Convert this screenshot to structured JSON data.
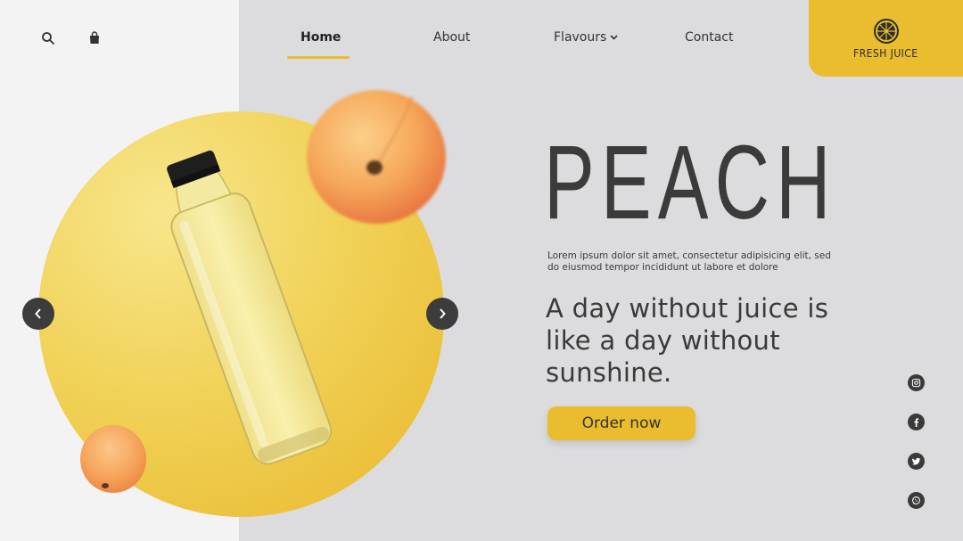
{
  "header": {
    "icons": {
      "search": "search-icon",
      "bag": "shopping-bag-icon"
    },
    "nav": [
      {
        "label": "Home",
        "active": true
      },
      {
        "label": "About",
        "active": false
      },
      {
        "label": "Flavours",
        "active": false,
        "dropdown": true
      },
      {
        "label": "Contact",
        "active": false
      }
    ],
    "logo": {
      "text": "FRESH JUICE",
      "icon": "citrus-slice-icon"
    }
  },
  "hero": {
    "title": "PEACH",
    "description": "Lorem ipsum dolor sit amet, consectetur adipisicing elit, sed do eiusmod tempor incididunt ut labore et dolore",
    "tagline": "A day without juice is like a day without sunshine.",
    "cta_label": "Order now"
  },
  "carousel": {
    "prev_icon": "chevron-left-icon",
    "next_icon": "chevron-right-icon"
  },
  "social": [
    "instagram-icon",
    "facebook-icon",
    "twitter-icon",
    "whatsapp-icon"
  ],
  "colors": {
    "accent": "#e9bd2e",
    "left_bg": "#f3f3f4",
    "right_bg": "#dcdcdf",
    "text_dark": "#3b3b3b"
  }
}
